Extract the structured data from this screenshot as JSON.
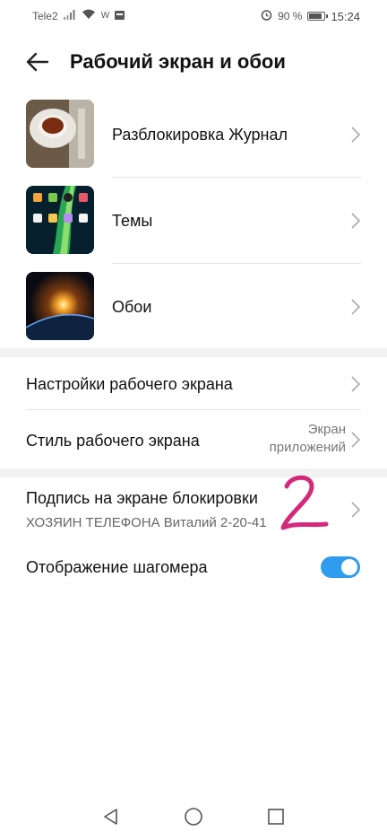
{
  "status_bar": {
    "carrier": "Tele2",
    "network_indicator": "W",
    "battery_percent": "90 %",
    "battery_level": 0.9,
    "time": "15:24",
    "icons": [
      "signal-icon",
      "wifi-icon",
      "notification-icon",
      "alarm-icon",
      "battery-icon"
    ]
  },
  "header": {
    "title": "Рабочий экран и обои",
    "back_icon": "back-arrow-icon"
  },
  "theme_items": [
    {
      "label": "Разблокировка Журнал",
      "thumbnail": "tea-cup-photo"
    },
    {
      "label": "Темы",
      "thumbnail": "aurora-homescreen-preview"
    },
    {
      "label": "Обои",
      "thumbnail": "earth-sunrise-photo"
    }
  ],
  "settings": {
    "home_screen_settings": {
      "label": "Настройки рабочего экрана"
    },
    "home_screen_style": {
      "label": "Стиль рабочего экрана",
      "value_line1": "Экран",
      "value_line2": "приложений"
    },
    "lock_screen_signature": {
      "label": "Подпись на экране блокировки",
      "value": "ХОЗЯИН ТЕЛЕФОНА Виталий 2-20-41"
    },
    "pedometer_display": {
      "label": "Отображение шагомера",
      "enabled": true
    }
  },
  "annotation": {
    "text": "2",
    "color": "#d4287a"
  },
  "colors": {
    "accent": "#2f9cf0",
    "divider": "#e4e4e4",
    "section_gap": "#f2f2f2"
  },
  "nav_bar": {
    "icons": [
      "back-triangle-icon",
      "home-circle-icon",
      "recents-square-icon"
    ]
  }
}
